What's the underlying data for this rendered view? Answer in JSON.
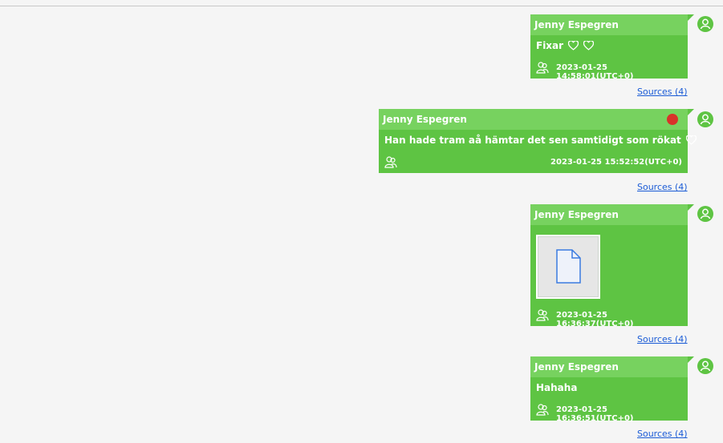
{
  "messages": [
    {
      "sender": "Jenny Espegren",
      "text": "Fixar",
      "hearts": 2,
      "timestamp": "2023-01-25 14:58:01(UTC+0)",
      "sources": "Sources (4)"
    },
    {
      "sender": "Jenny Espegren",
      "text": "Han hade tram aå hämtar det sen samtidigt som rökat",
      "hearts": 1,
      "status_dot": "red",
      "timestamp": "2023-01-25 15:52:52(UTC+0)",
      "sources": "Sources (4)"
    },
    {
      "sender": "Jenny Espegren",
      "attachment": "file-icon",
      "timestamp": "2023-01-25 16:36:37(UTC+0)",
      "sources": "Sources (4)"
    },
    {
      "sender": "Jenny Espegren",
      "text": "Hahaha",
      "timestamp": "2023-01-25 16:36:51(UTC+0)",
      "sources": "Sources (4)"
    }
  ],
  "colors": {
    "bubble": "#5ec443",
    "header": "#77d25f",
    "link": "#1a5bd6",
    "status_dot": "#d8322a"
  }
}
